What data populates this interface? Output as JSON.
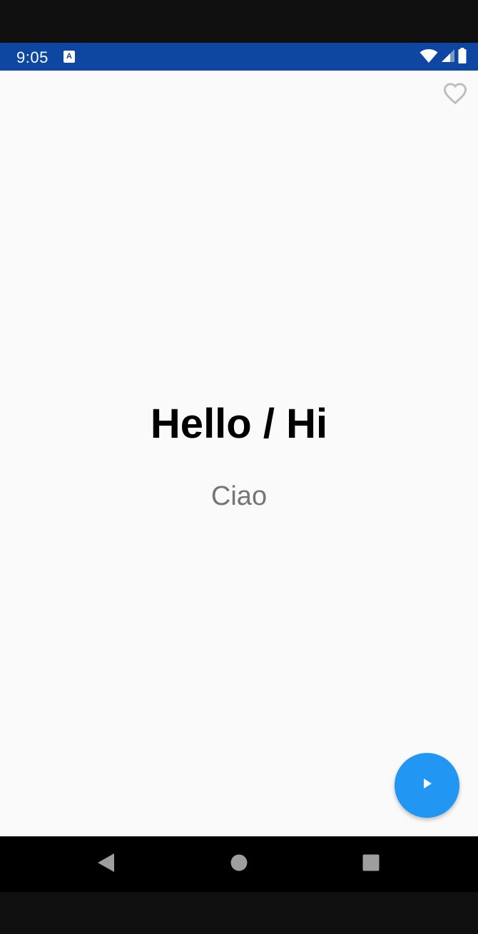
{
  "status_bar": {
    "time": "9:05",
    "notification_icon": "accessibility-a-icon",
    "notification_letter": "A",
    "icons": [
      "wifi-icon",
      "cell-signal-icon",
      "battery-icon"
    ],
    "background_color": "#0d47a1"
  },
  "card": {
    "phrase": "Hello / Hi",
    "translation": "Ciao",
    "favorite_icon": "heart-outline-icon"
  },
  "fab": {
    "icon": "play-icon",
    "color": "#2196f3"
  },
  "navigation_bar": {
    "buttons": [
      "back-icon",
      "home-icon",
      "recents-icon"
    ]
  }
}
